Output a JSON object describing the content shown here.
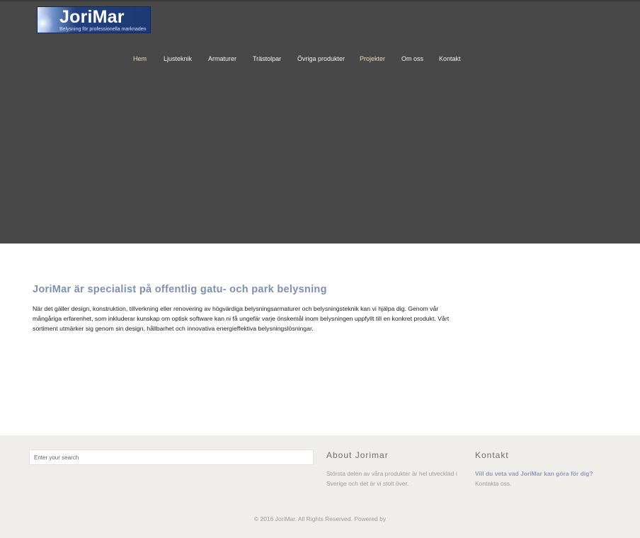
{
  "brand": {
    "name": "JoriMar",
    "tagline": "Belysning för professionella marknaden"
  },
  "nav": {
    "items": [
      {
        "label": "Hem",
        "active": true
      },
      {
        "label": "Ljusteknik",
        "active": false
      },
      {
        "label": "Armaturer",
        "active": false
      },
      {
        "label": "Trästolpar",
        "active": false
      },
      {
        "label": "Övriga produkter",
        "active": false
      },
      {
        "label": "Projekter",
        "active": true
      },
      {
        "label": "Om oss",
        "active": false
      },
      {
        "label": "Kontakt",
        "active": false
      }
    ]
  },
  "main": {
    "title": "JoriMar är specialist på offentlig gatu- och park belysning",
    "body": "När det gäller design, konstruktion, tillverkning eller renovering av högvärdiga belysningsarmaturer och belysningsteknik kan vi hjälpa dig. Genom vår mångåriga erfarenhet, som inkluderar kunskap om optisk software kan ni få ungefär varje önskemål inom belysningen uppfyllt till en konkret produkt. Vårt sortiment utmärker sig genom sin design, hållbarhet och innovativa energieffektiva belysningslösningar."
  },
  "footer": {
    "search_placeholder": "Enter your search",
    "about_heading": "About Jorimar",
    "about_text": "Största delen av våra produkter är hel utvecklad i Sverige och det är vi stolt över.",
    "contact_heading": "Kontakt",
    "contact_link": "Vill du veta vad JoriMar kan göra för dig?",
    "contact_text": "Kontakta oss.",
    "copyright": "© 2016 JoriMar. All Rights Reserved. Powered by"
  },
  "colors": {
    "header_bg": "#484848",
    "nav_active": "#efdcae",
    "title_color": "#7e8fb0",
    "footer_bg": "#efeeea"
  }
}
